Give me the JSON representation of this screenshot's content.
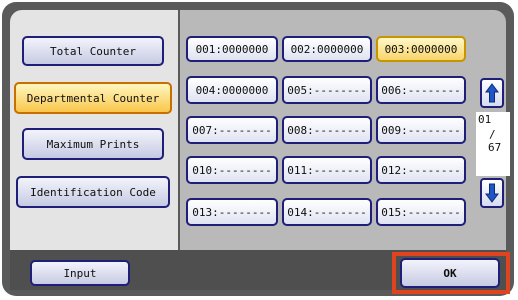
{
  "left_menu": [
    {
      "label": "Total Counter",
      "selected": false
    },
    {
      "label": "Departmental Counter",
      "selected": true
    },
    {
      "label": "Maximum Prints",
      "selected": false
    },
    {
      "label": "Identification Code",
      "selected": false
    }
  ],
  "counters": [
    {
      "label": "001:0000000",
      "selected": false
    },
    {
      "label": "002:0000000",
      "selected": false
    },
    {
      "label": "003:0000000",
      "selected": true
    },
    {
      "label": "004:0000000",
      "selected": false
    },
    {
      "label": "005:--------",
      "selected": false
    },
    {
      "label": "006:--------",
      "selected": false
    },
    {
      "label": "007:--------",
      "selected": false
    },
    {
      "label": "008:--------",
      "selected": false
    },
    {
      "label": "009:--------",
      "selected": false
    },
    {
      "label": "010:--------",
      "selected": false
    },
    {
      "label": "011:--------",
      "selected": false
    },
    {
      "label": "012:--------",
      "selected": false
    },
    {
      "label": "013:--------",
      "selected": false
    },
    {
      "label": "014:--------",
      "selected": false
    },
    {
      "label": "015:--------",
      "selected": false
    }
  ],
  "pagination": {
    "current": "01",
    "separator": "/",
    "total": "67"
  },
  "scroll": {
    "up_icon": "up-arrow-icon",
    "down_icon": "down-arrow-icon"
  },
  "bottom": {
    "input_label": "Input",
    "ok_label": "OK"
  },
  "colors": {
    "highlight": "#e0431f",
    "selected": "#f8d56c",
    "border": "#1f1f7a"
  }
}
